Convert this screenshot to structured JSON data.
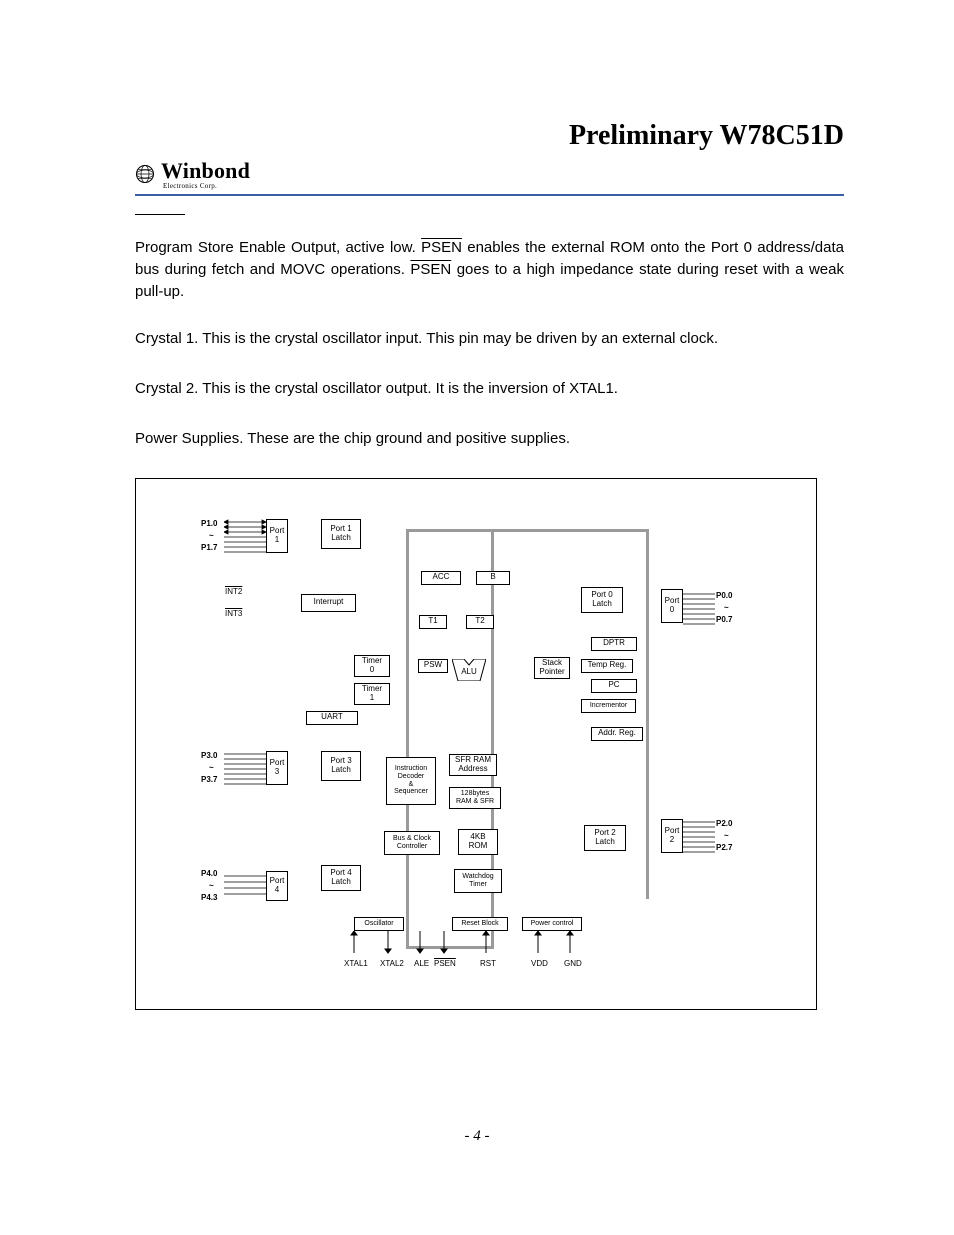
{
  "header": {
    "title": "Preliminary W78C51D",
    "brand": "Winbond",
    "brand_sub": "Electronics Corp."
  },
  "paragraphs": {
    "p1a": "Program Store Enable Output, active low. ",
    "p1_sig1": "PSEN",
    "p1b": " enables the external ROM onto the Port 0 address/data bus during fetch and MOVC operations. ",
    "p1_sig2": "PSEN",
    "p1c": " goes to a high impedance state during reset with a weak pull-up.",
    "p2": "Crystal 1. This is the crystal oscillator input. This pin may be driven by an external clock.",
    "p3": "Crystal 2. This is the crystal oscillator output. It is the inversion of XTAL1.",
    "p4": "Power Supplies. These are the chip ground and positive supplies."
  },
  "diagram": {
    "port_labels": {
      "p1_top": "P1.0",
      "p1_mid": "~",
      "p1_bot": "P1.7",
      "p3_top": "P3.0",
      "p3_mid": "~",
      "p3_bot": "P3.7",
      "p4_top": "P4.0",
      "p4_mid": "~",
      "p4_bot": "P4.3",
      "p0_top": "P0.0",
      "p0_mid": "~",
      "p0_bot": "P0.7",
      "p2_top": "P2.0",
      "p2_mid": "~",
      "p2_bot": "P2.7",
      "int2": "INT2",
      "int3": "INT3"
    },
    "blocks": {
      "port1": "Port\n1",
      "port1_latch": "Port 1\nLatch",
      "interrupt": "Interrupt",
      "acc": "ACC",
      "b": "B",
      "t1": "T1",
      "t2": "T2",
      "timer0": "Timer\n0",
      "timer1": "Timer\n1",
      "psw": "PSW",
      "alu": "ALU",
      "sp": "Stack\nPointer",
      "uart": "UART",
      "port0_latch": "Port 0\nLatch",
      "port0": "Port\n0",
      "dptr": "DPTR",
      "temp": "Temp Reg.",
      "pc": "PC",
      "incr": "Incrementor",
      "addr": "Addr. Reg.",
      "port3": "Port\n3",
      "port3_latch": "Port 3\nLatch",
      "ids": "Instruction\nDecoder\n&\nSequencer",
      "sfr_addr": "SFR RAM\nAddress",
      "ram": "128bytes\nRAM & SFR",
      "rom": "4KB\nROM",
      "port2_latch": "Port 2\nLatch",
      "port2": "Port\n2",
      "bus_clk": "Bus & Clock\nController",
      "port4": "Port\n4",
      "port4_latch": "Port 4\nLatch",
      "wdt": "Watchdog\nTimer",
      "osc": "Oscillator",
      "reset": "Reset Block",
      "pwr": "Power control"
    },
    "bottom_labels": {
      "xtal1": "XTAL1",
      "xtal2": "XTAL2",
      "ale": "ALE",
      "psen": "PSEN",
      "rst": "RST",
      "vdd": "VDD",
      "gnd": "GND"
    }
  },
  "page_number": "- 4 -"
}
